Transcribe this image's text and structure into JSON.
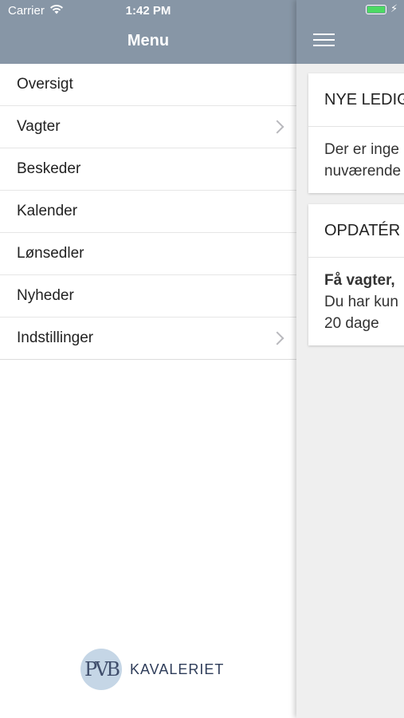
{
  "status_bar": {
    "carrier": "Carrier",
    "time": "1:42 PM",
    "battery_color": "#4cd964"
  },
  "menu": {
    "title": "Menu",
    "items": [
      {
        "label": "Oversigt",
        "has_chevron": false
      },
      {
        "label": "Vagter",
        "has_chevron": true
      },
      {
        "label": "Beskeder",
        "has_chevron": false
      },
      {
        "label": "Kalender",
        "has_chevron": false
      },
      {
        "label": "Lønsedler",
        "has_chevron": false
      },
      {
        "label": "Nyheder",
        "has_chevron": false
      },
      {
        "label": "Indstillinger",
        "has_chevron": true
      }
    ]
  },
  "logo": {
    "mark": "PVB",
    "text": "KAVALERIET"
  },
  "content": {
    "cards": [
      {
        "title": "NYE LEDIG",
        "body_lines": [
          "Der er inge",
          "nuværende"
        ]
      },
      {
        "title": "OPDATÉR",
        "body_bold": "Få vagter,",
        "body_lines": [
          "Du har kun",
          "20 dage"
        ]
      }
    ]
  },
  "colors": {
    "header": "#8796a6",
    "background": "#efefef",
    "accent": "#4cd964"
  },
  "icons": [
    "wifi-icon",
    "chevron-right-icon",
    "hamburger-menu-icon",
    "battery-icon",
    "charging-bolt-icon"
  ]
}
